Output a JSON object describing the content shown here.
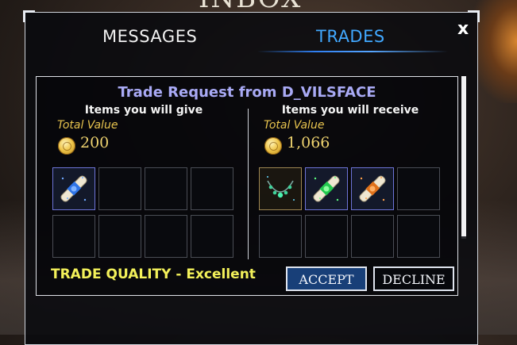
{
  "background": {
    "header_text": "INBOX"
  },
  "inbox": {
    "tabs": [
      {
        "label": "MESSAGES",
        "active": false
      },
      {
        "label": "TRADES",
        "active": true
      }
    ],
    "close_label": "x"
  },
  "trade": {
    "title": "Trade Request from D_VILSFACE",
    "give": {
      "heading": "Items you will give",
      "total_label": "Total Value",
      "total_value": "200",
      "items": [
        {
          "icon": "scroll-blue-icon",
          "color": "#3a7de8"
        }
      ]
    },
    "receive": {
      "heading": "Items you will receive",
      "total_label": "Total Value",
      "total_value": "1,066",
      "items": [
        {
          "icon": "necklace-teal-icon",
          "color": "#3fd39a"
        },
        {
          "icon": "scroll-green-icon",
          "color": "#2fd65a"
        },
        {
          "icon": "scroll-orange-icon",
          "color": "#e67c1f"
        }
      ]
    },
    "quality_text": "TRADE QUALITY - Excellent",
    "accept_label": "ACCEPT",
    "decline_label": "DECLINE"
  },
  "colors": {
    "title": "#a9aaf5",
    "tab_active": "#41a8ff",
    "quality": "#f3f15a",
    "currency": "#eed26f",
    "accept_bg": "#183f78"
  }
}
